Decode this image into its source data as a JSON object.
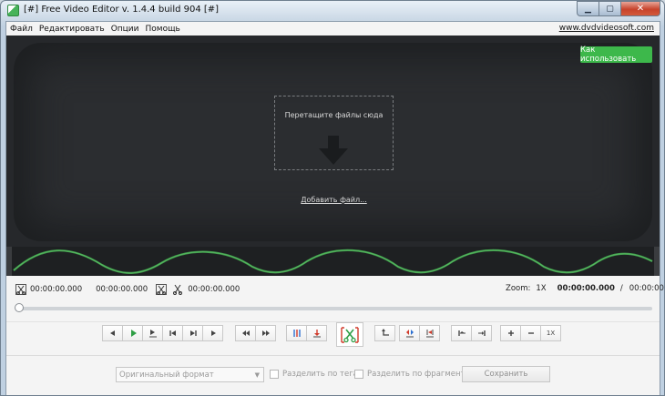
{
  "window": {
    "title": "[#] Free Video Editor v. 1.4.4 build 904 [#]",
    "min_glyph": "▁",
    "max_glyph": "▢",
    "close_glyph": "✕"
  },
  "menu": {
    "items": [
      "Файл",
      "Редактировать",
      "Опции",
      "Помощь"
    ],
    "site_link": "www.dvdvideosoft.com"
  },
  "stage": {
    "howto_button": "Как использовать",
    "drop_text": "Перетащите файлы сюда",
    "add_file": "Добавить файл..."
  },
  "timeline": {
    "start_time": "00:00:00.000",
    "end_time": "00:00:00.000",
    "selection_time": "00:00:00.000",
    "zoom_label": "Zoom:",
    "zoom_value": "1X",
    "current_time": "00:00:00.000",
    "separator": "/",
    "total_time": "00:00:00.000"
  },
  "controls": {
    "speed_label": "1X"
  },
  "bottom": {
    "format_placeholder": "Оригинальный формат",
    "split_by_tags": "Разделить по тегам",
    "split_by_fragments": "Разделить по фрагментам",
    "save_button": "Сохранить"
  },
  "colors": {
    "accent_green": "#3db84b",
    "stage_bg": "#26282b",
    "wave_green": "#3f9a4a"
  }
}
